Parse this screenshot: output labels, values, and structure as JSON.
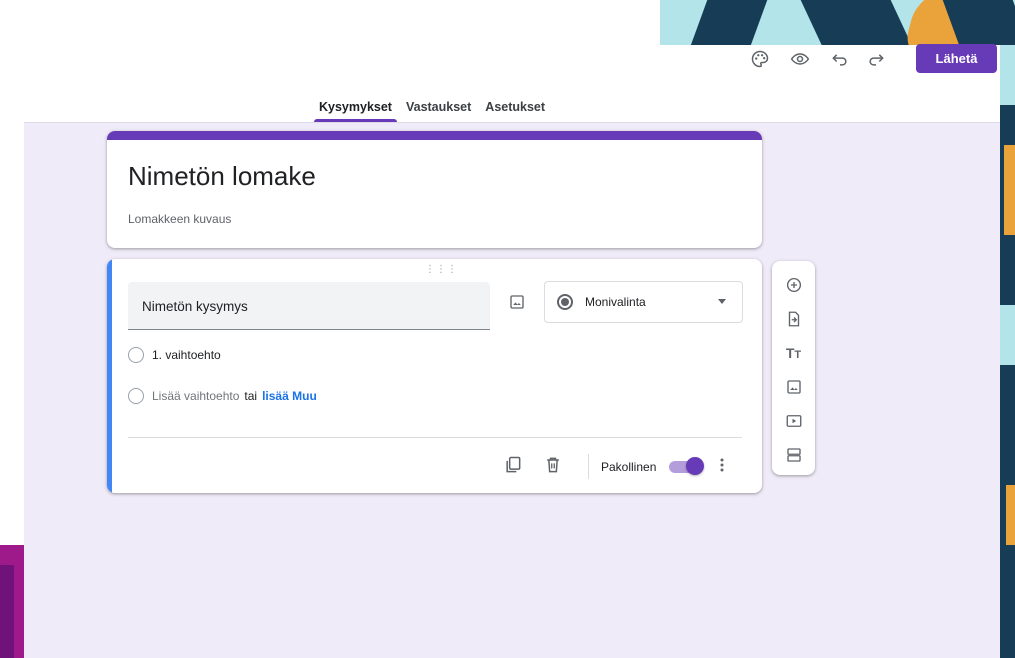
{
  "toolbar": {
    "icons": [
      "palette-icon",
      "preview-eye-icon",
      "undo-icon",
      "redo-icon"
    ],
    "send_label": "Lähetä"
  },
  "tabs": [
    {
      "label": "Kysymykset",
      "active": true
    },
    {
      "label": "Vastaukset",
      "active": false
    },
    {
      "label": "Asetukset",
      "active": false
    }
  ],
  "form": {
    "title": "Nimetön lomake",
    "description_placeholder": "Lomakkeen kuvaus"
  },
  "question": {
    "title": "Nimetön kysymys",
    "type": "Monivalinta",
    "options": [
      "1. vaihtoehto"
    ],
    "add_option": "Lisää vaihtoehto",
    "or_text": "tai",
    "add_other": "lisää Muu",
    "required_label": "Pakollinen",
    "required": true
  },
  "side_tools": [
    "add-question-icon",
    "import-questions-icon",
    "add-title-icon",
    "add-image-icon",
    "add-video-icon",
    "add-section-icon"
  ],
  "colors": {
    "accent": "#673ab7",
    "surface": "#f0ebf8",
    "focus_bar": "#4285f4",
    "link": "#1a73e8"
  }
}
